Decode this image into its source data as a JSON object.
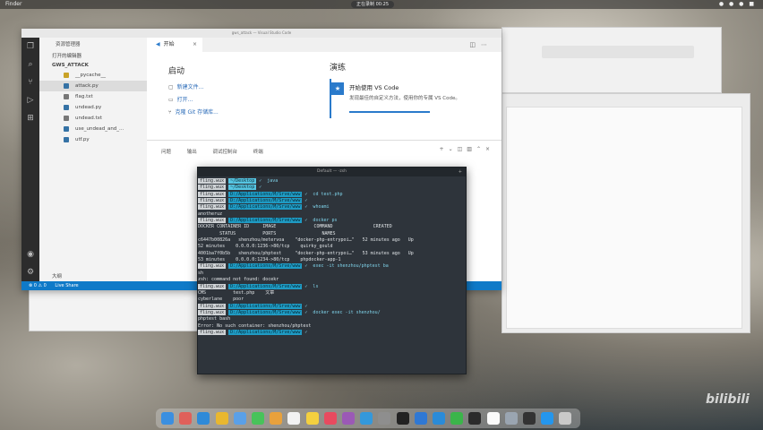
{
  "menubar": {
    "left": "Finder",
    "center": "正在录制 00:25",
    "right": "● ● ● ■"
  },
  "vscode": {
    "title": "gws_attack — Visual Studio Code",
    "sidebar": {
      "header": "资源管理器",
      "open_editors": "打开的编辑器",
      "folder": "GWS_ATTACK",
      "files": [
        {
          "name": "__pycache__",
          "icon": "folder-icon",
          "color": "#c9a227"
        },
        {
          "name": "attack.py",
          "icon": "python-icon",
          "color": "#3572a5"
        },
        {
          "name": "flag.txt",
          "icon": "text-file-icon",
          "color": "#777777"
        },
        {
          "name": "undead.py",
          "icon": "python-icon",
          "color": "#3572a5"
        },
        {
          "name": "undead.txt",
          "icon": "text-file-icon",
          "color": "#777777"
        },
        {
          "name": "use_undead_and_...",
          "icon": "python-icon",
          "color": "#3572a5"
        },
        {
          "name": "utf.py",
          "icon": "python-icon",
          "color": "#3572a5"
        }
      ],
      "outline": "大纲"
    },
    "tab": {
      "label": "开始",
      "close": "×"
    },
    "start": {
      "heading": "启动",
      "actions": [
        {
          "icon": "new-file-icon",
          "label": "新建文件..."
        },
        {
          "icon": "open-folder-icon",
          "label": "打开..."
        },
        {
          "icon": "git-icon",
          "label": "克隆 Git 存储库..."
        }
      ]
    },
    "walkthrough": {
      "heading": "演练",
      "badge": "★",
      "title": "开始使用 VS Code",
      "desc": "发现最佳的自定义方法，使用你的专属 VS Code。"
    },
    "panel_tabs": [
      "问题",
      "输出",
      "调试控制台",
      "终端"
    ],
    "status": {
      "left": "⊗ 0 ⚠ 0",
      "live": "Live Share"
    }
  },
  "terminal": {
    "title": "Default — -zsh",
    "lines": [
      {
        "prompt": "fling.wux",
        "path": "~/Desktop",
        "cmd": "✓  java"
      },
      {
        "prompt": "fling.wux",
        "path": "~/Desktop",
        "cmd": "✓"
      },
      {
        "prompt": "fling.wux",
        "path": "D:/Applications/M/Srve/www",
        "cmd": "✓  cd test.php"
      },
      {
        "prompt": "fling.wux",
        "path": "D:/Applications/M/Srve/www",
        "cmd": "✓"
      },
      {
        "prompt": "fling.wux",
        "path": "D:/Applications/M/Srve/www",
        "cmd": "✓  whoami"
      },
      {
        "text": "anotheruz"
      },
      {
        "prompt": "fling.wux",
        "path": "D:/Applications/M/Srve/www",
        "cmd": "✓  docker ps"
      },
      {
        "text": "DOCKER CONTAINER ID     IMAGE              COMMAND               CREATED"
      },
      {
        "text": "        STATUS          PORTS                 NAMES"
      },
      {
        "text": "c6447b00826a   shenzhou/metervoa    \"docker-php-entrypoi…\"   52 minutes ago   Up"
      },
      {
        "text": "52 minutes    0.0.0.0:1236->80/tcp    quirky_gould"
      },
      {
        "text": "4001ba7f0b5b   shenzhou/phptest     \"docker-php-entrypoi…\"   53 minutes ago   Up"
      },
      {
        "text": "53 minutes    0.0.0.0:1234->80/tcp    phpdocker-app-1"
      },
      {
        "prompt": "fling.wux",
        "path": "D:/Applications/M/Srve/www",
        "cmd": "✓  exec -it shenzhou/phptest ba"
      },
      {
        "text": "sh"
      },
      {
        "text": "zsh: command not found: docekr"
      },
      {
        "prompt": "fling.wux",
        "path": "D:/Applications/M/Srve/www",
        "cmd": "✓  ls"
      },
      {
        "text": "CMS          test.php    文章"
      },
      {
        "text": "cyberlane    poor"
      },
      {
        "prompt": "fling.wux",
        "path": "D:/Applications/M/Srve/www",
        "cmd": "✓"
      },
      {
        "prompt": "fling.wux",
        "path": "D:/Applications/M/Srve/www",
        "cmd": "✓  docker exec -it shenzhou/"
      },
      {
        "text": "phptest bash"
      },
      {
        "text": "Error: No such container: shenzhou/phptest"
      },
      {
        "prompt": "fling.wux",
        "path": "D:/Applications/M/Srve/www",
        "cmd": "✓"
      }
    ]
  },
  "dock": {
    "apps": [
      {
        "name": "finder-icon",
        "color": "#3b8fe0"
      },
      {
        "name": "launchpad-icon",
        "color": "#e0605a"
      },
      {
        "name": "safari-icon",
        "color": "#2f8ad8"
      },
      {
        "name": "chrome-icon",
        "color": "#e9b72f"
      },
      {
        "name": "mail-icon",
        "color": "#5aa0e8"
      },
      {
        "name": "messages-icon",
        "color": "#48c35a"
      },
      {
        "name": "photos-icon",
        "color": "#e8a13c"
      },
      {
        "name": "calendar-icon",
        "color": "#f2f2f2"
      },
      {
        "name": "notes-icon",
        "color": "#f4d03f"
      },
      {
        "name": "music-icon",
        "color": "#e84a5f"
      },
      {
        "name": "podcasts-icon",
        "color": "#9b59b6"
      },
      {
        "name": "appstore-icon",
        "color": "#3498db"
      },
      {
        "name": "settings-icon",
        "color": "#8e8e8e"
      },
      {
        "name": "terminal-icon",
        "color": "#222222"
      },
      {
        "name": "xcode-icon",
        "color": "#2f78d4"
      },
      {
        "name": "vscode-icon",
        "color": "#2a8bd8"
      },
      {
        "name": "wechat-icon",
        "color": "#3bb54a"
      },
      {
        "name": "qq-icon",
        "color": "#2b2b2b"
      },
      {
        "name": "text-icon",
        "color": "#fafafa"
      },
      {
        "name": "preview-icon",
        "color": "#9aa5b1"
      },
      {
        "name": "activity-icon",
        "color": "#333333"
      },
      {
        "name": "docker-icon",
        "color": "#2496ed"
      },
      {
        "name": "trash-icon",
        "color": "#c9c9c9"
      }
    ]
  },
  "watermark": "bilibili"
}
